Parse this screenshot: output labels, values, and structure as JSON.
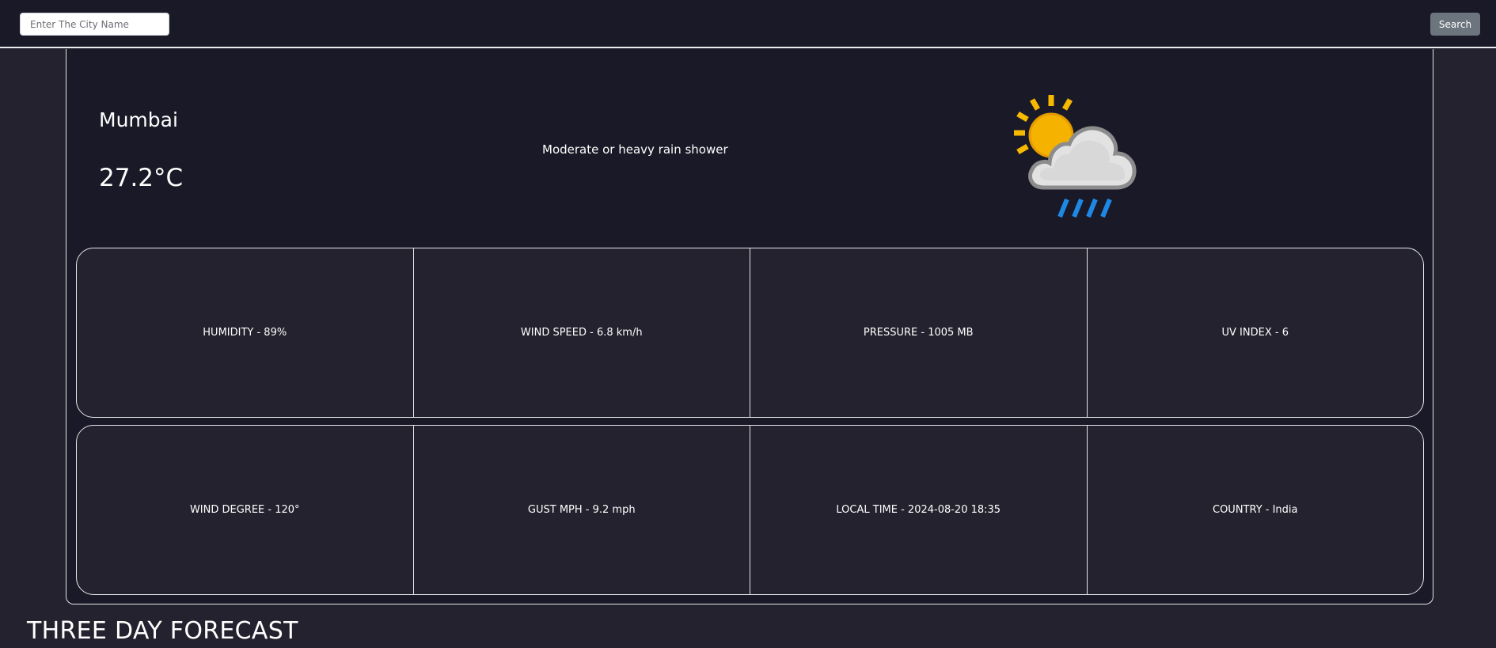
{
  "search": {
    "placeholder": "Enter The City Name",
    "value": "",
    "button_label": "Search"
  },
  "current": {
    "city": "Mumbai",
    "temperature": "27.2°C",
    "condition": "Moderate or heavy rain shower",
    "icon": "sun-cloud-rain-icon"
  },
  "stats": [
    {
      "label": "HUMIDITY - 89%"
    },
    {
      "label": "WIND SPEED - 6.8 km/h"
    },
    {
      "label": "PRESSURE - 1005 MB"
    },
    {
      "label": "UV INDEX - 6"
    },
    {
      "label": "WIND DEGREE - 120°"
    },
    {
      "label": "GUST MPH - 9.2 mph"
    },
    {
      "label": "LOCAL TIME - 2024-08-20 18:35"
    },
    {
      "label": "COUNTRY - India"
    }
  ],
  "forecast": {
    "title": "THREE DAY FORECAST"
  },
  "colors": {
    "background": "#23222e",
    "card": "#1a1927",
    "border": "#e6e6ea",
    "button": "#6c757d",
    "sun": "#f7b800",
    "rain": "#1e88e5"
  }
}
